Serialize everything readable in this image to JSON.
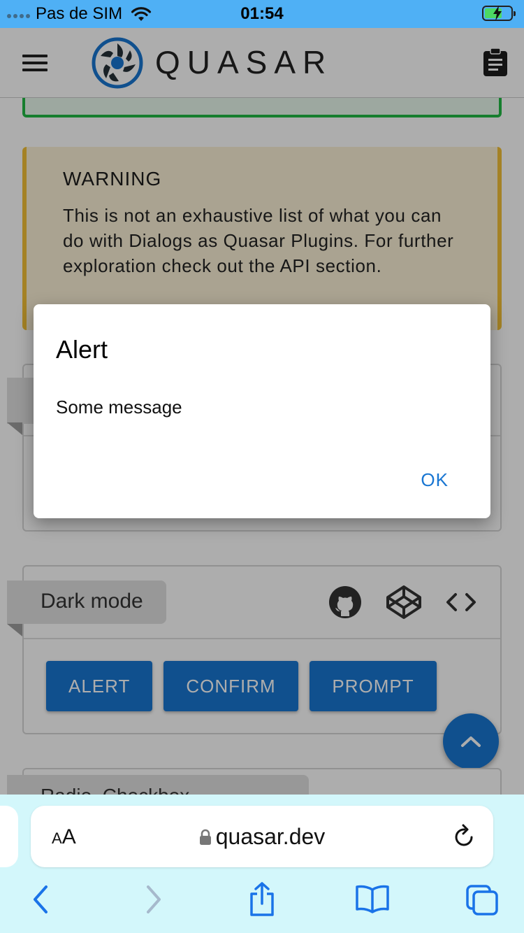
{
  "status": {
    "carrier": "Pas de SIM",
    "time": "01:54"
  },
  "header": {
    "brand": "QUASAR"
  },
  "warning": {
    "title": "WARNING",
    "text": "This is not an exhaustive list of what you can do with Dialogs as Quasar Plugins. For further exploration check out the API section."
  },
  "example_card": {
    "title": "Dark mode",
    "buttons": [
      "ALERT",
      "CONFIRM",
      "PROMPT"
    ]
  },
  "next_card": {
    "title_partial": "Radio, Checkbox"
  },
  "dialog": {
    "title": "Alert",
    "message": "Some message",
    "ok_label": "OK"
  },
  "browser": {
    "aa_label": "AA",
    "url": "quasar.dev"
  },
  "colors": {
    "primary": "#1976d2",
    "warning": "#f2c037",
    "positive": "#21ba45",
    "status_bar": "#4fb0f5",
    "safari_bar": "#d3f7fb"
  }
}
